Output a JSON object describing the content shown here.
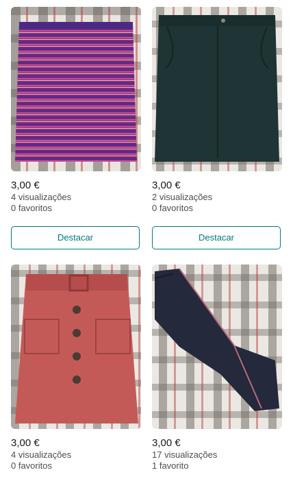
{
  "items": [
    {
      "photo_icon": "striped-skirt-photo",
      "price": "3,00 €",
      "views": "4 visualizações",
      "favorites": "0 favoritos",
      "action_label": "Destacar"
    },
    {
      "photo_icon": "dark-green-skirt-photo",
      "price": "3,00 €",
      "views": "2 visualizações",
      "favorites": "0 favoritos",
      "action_label": "Destacar"
    },
    {
      "photo_icon": "pink-button-skirt-photo",
      "price": "3,00 €",
      "views": "4 visualizações",
      "favorites": "0 favoritos"
    },
    {
      "photo_icon": "dark-jeans-photo",
      "price": "3,00 €",
      "views": "17 visualizações",
      "favorites": "1 favorito"
    }
  ],
  "colors": {
    "accent": "#007782",
    "price_text": "#171717",
    "meta_text": "#4d4d4d"
  }
}
